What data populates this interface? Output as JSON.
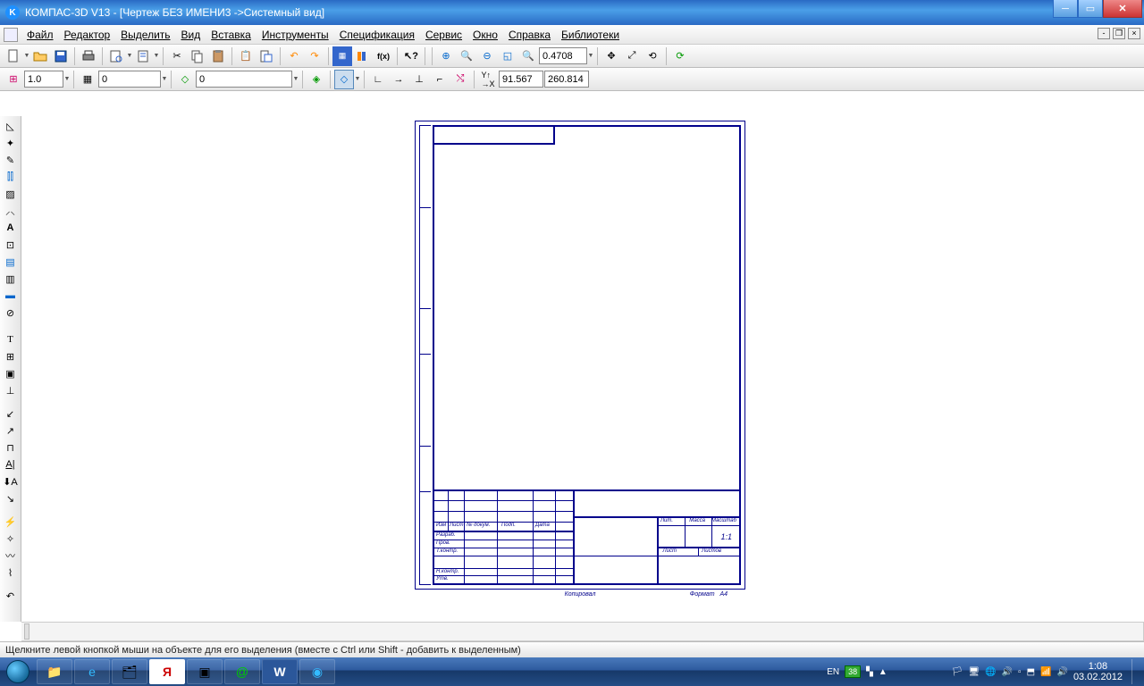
{
  "title": "КОМПАС-3D V13 - [Чертеж БЕЗ ИМЕНИ3 ->Системный вид]",
  "menu": {
    "file": "Файл",
    "editor": "Редактор",
    "select": "Выделить",
    "view": "Вид",
    "insert": "Вставка",
    "tools": "Инструменты",
    "spec": "Спецификация",
    "service": "Сервис",
    "window": "Окно",
    "help": "Справка",
    "libs": "Библиотеки"
  },
  "toolbar2": {
    "zoom": "0.4708",
    "coord_x": "91.567",
    "coord_y": "260.814"
  },
  "toolbar3": {
    "width": "1.0",
    "step": "0",
    "layer": "0"
  },
  "drawing": {
    "copied": "Копировал",
    "format": "Формат",
    "format_size": "А4",
    "scale": "1:1",
    "fields": {
      "izm": "Изм",
      "list": "Лист",
      "ndokum": "№ докум.",
      "podp": "Подп.",
      "data": "Дата",
      "razrab": "Разраб.",
      "prov": "Пров.",
      "tkontr": "Т.контр.",
      "nkontr": "Н.контр.",
      "utv": "Утв.",
      "lit": "Лит.",
      "massa": "Масса",
      "masshtab": "Масштаб",
      "list2": "Лист",
      "listov": "Листов"
    }
  },
  "status": "Щелкните левой кнопкой мыши на объекте для его выделения (вместе с Ctrl или Shift - добавить к выделенным)",
  "tray": {
    "lang": "EN",
    "time": "1:08",
    "date": "03.02.2012"
  }
}
